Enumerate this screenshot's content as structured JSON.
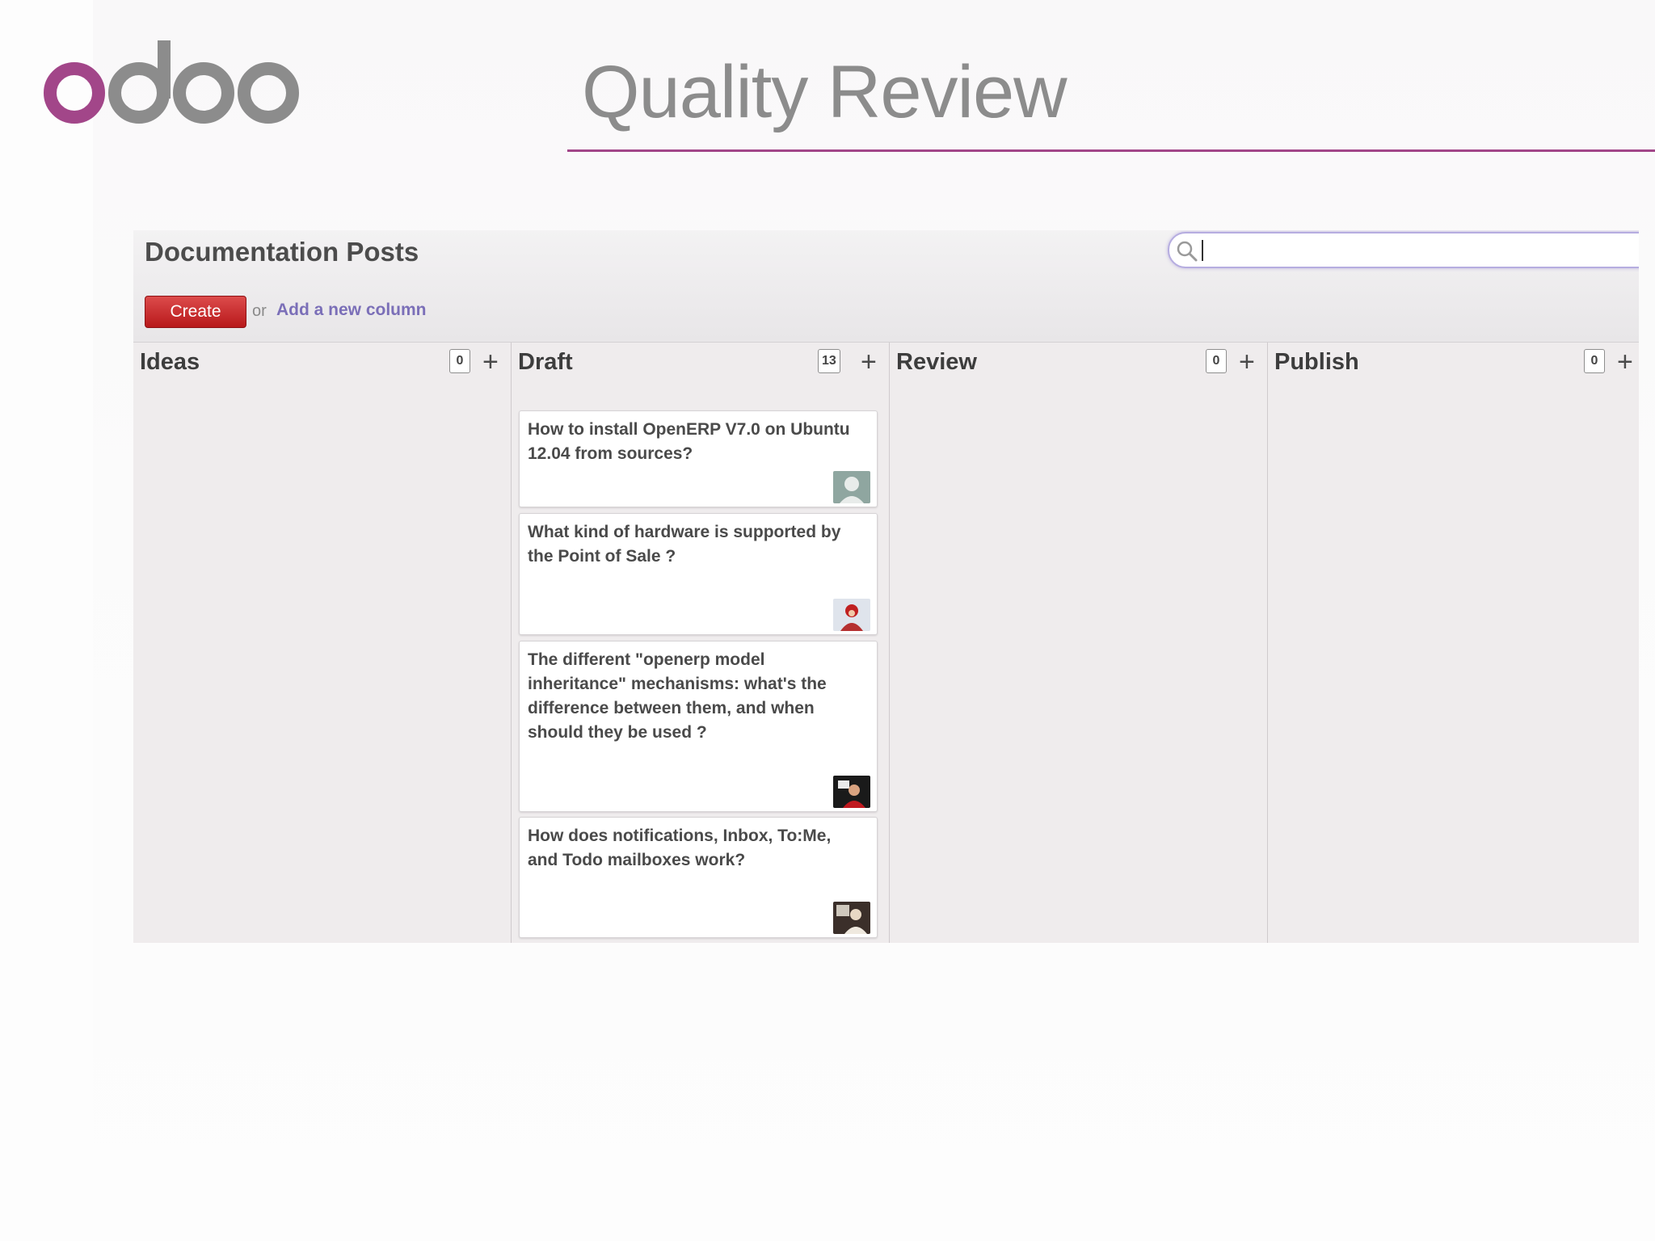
{
  "slide": {
    "logo_text": "odoo",
    "title": "Quality Review",
    "accent": "#a24689"
  },
  "app": {
    "title": "Documentation Posts",
    "search": {
      "value": "",
      "placeholder": ""
    },
    "create_label": "Create",
    "or_text": "or",
    "add_column_label": "Add a new column",
    "colors": {
      "create_button": "#c62828",
      "link": "#7b6fb8"
    }
  },
  "columns": [
    {
      "title": "Ideas",
      "count": "0",
      "add_label": "+",
      "cards": []
    },
    {
      "title": "Draft",
      "count": "13",
      "add_label": "+",
      "cards": [
        {
          "text": "How to install OpenERP V7.0 on Ubuntu 12.04 from sources?",
          "avatar": "default-user-avatar"
        },
        {
          "text": "What kind of hardware is supported by the Point of Sale ?",
          "avatar": "user-avatar-red"
        },
        {
          "text": "The different \"openerp model inheritance\" mechanisms: what's the difference between them, and when should they be used ?",
          "avatar": "user-avatar-dark"
        },
        {
          "text": "How does notifications, Inbox, To:Me, and Todo mailboxes work?",
          "avatar": "user-avatar-photo"
        }
      ]
    },
    {
      "title": "Review",
      "count": "0",
      "add_label": "+",
      "cards": []
    },
    {
      "title": "Publish",
      "count": "0",
      "add_label": "+",
      "cards": []
    }
  ]
}
